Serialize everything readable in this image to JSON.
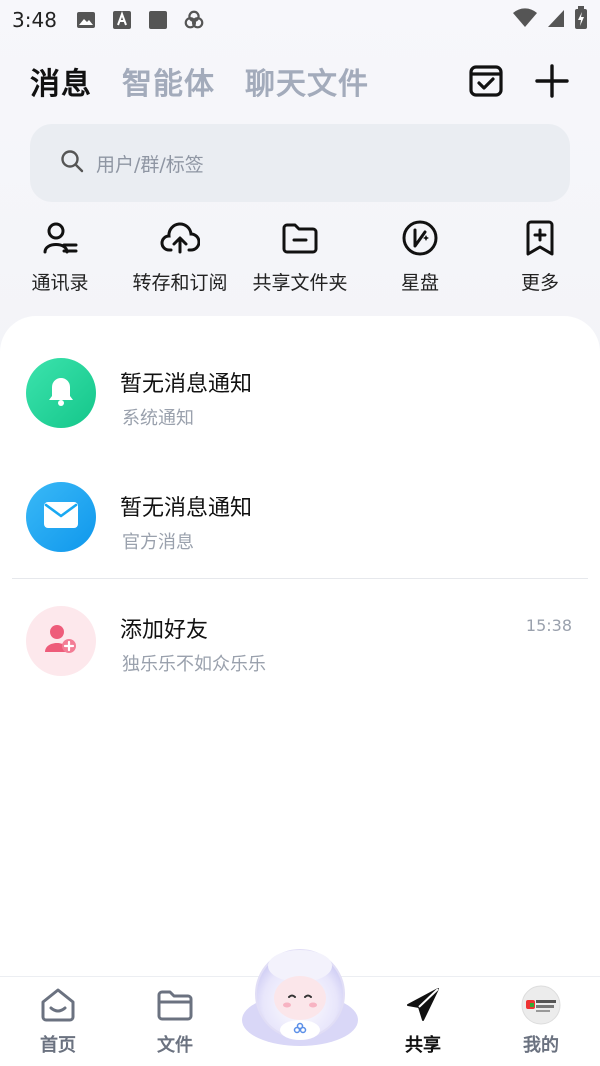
{
  "status_bar": {
    "time": "3:48"
  },
  "header": {
    "tabs": [
      {
        "label": "消息",
        "active": true
      },
      {
        "label": "智能体",
        "active": false
      },
      {
        "label": "聊天文件",
        "active": false
      }
    ],
    "actions": {
      "calendar_icon": "calendar-check-icon",
      "add_icon": "plus-icon"
    }
  },
  "search": {
    "placeholder": "用户/群/标签"
  },
  "quick_actions": [
    {
      "label": "通讯录",
      "icon": "contacts-icon"
    },
    {
      "label": "转存和订阅",
      "icon": "cloud-upload-icon"
    },
    {
      "label": "共享文件夹",
      "icon": "folder-minus-icon"
    },
    {
      "label": "星盘",
      "icon": "star-disk-icon"
    },
    {
      "label": "更多",
      "icon": "bookmark-plus-icon"
    }
  ],
  "messages": [
    {
      "title": "暂无消息通知",
      "subtitle": "系统通知",
      "time": "",
      "avatar_color": "#1dd39a",
      "icon": "bell-icon"
    },
    {
      "title": "暂无消息通知",
      "subtitle": "官方消息",
      "time": "",
      "avatar_color": "#19a9f2",
      "icon": "mail-icon"
    },
    {
      "title": "添加好友",
      "subtitle": "独乐乐不如众乐乐",
      "time": "15:38",
      "avatar_color": "#fde8ec",
      "icon": "add-friend-icon"
    }
  ],
  "bottom_nav": [
    {
      "label": "首页",
      "active": false
    },
    {
      "label": "文件",
      "active": false
    },
    {
      "label": "共享",
      "active": true
    },
    {
      "label": "我的",
      "active": false
    }
  ],
  "colors": {
    "accent_text": "#111111",
    "muted": "#a3abbb",
    "search_bg": "#eaedf2"
  }
}
